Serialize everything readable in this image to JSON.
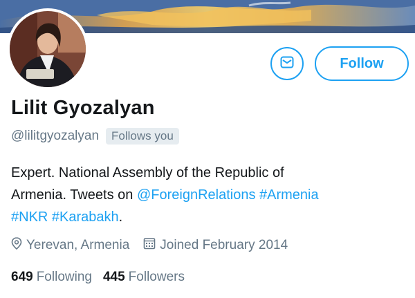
{
  "profile": {
    "name": "Lilit Gyozalyan",
    "handle": "@lilitgyozalyan",
    "follows_you": "Follows you",
    "bio": {
      "line1": "Expert. National Assembly of the Republic of",
      "line2_text": "Armenia. Tweets on ",
      "mention": "@ForeignRelations",
      "hashtag1": "#Armenia",
      "hashtag2": "#NKR",
      "hashtag3": "#Karabakh",
      "end": "."
    },
    "location": "Yerevan, Armenia",
    "joined": "Joined February 2014",
    "following_count": "649",
    "following_label": "Following",
    "followers_count": "445",
    "followers_label": "Followers"
  },
  "actions": {
    "follow_label": "Follow"
  },
  "icons": {
    "message": "message-icon",
    "location": "location-pin-icon",
    "calendar": "calendar-icon"
  },
  "colors": {
    "accent": "#1da1f2",
    "secondary_text": "#657786",
    "primary_text": "#14171a"
  }
}
